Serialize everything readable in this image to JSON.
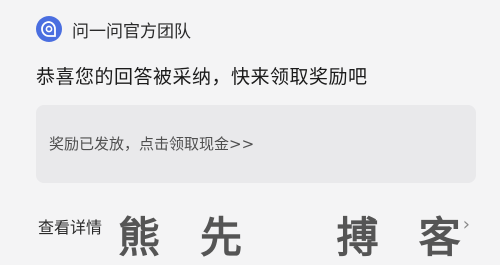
{
  "header": {
    "sender_name": "问一问官方团队",
    "avatar_icon": "question-bubble-icon",
    "accent_color": "#4a6ee0"
  },
  "message": {
    "text": "恭喜您的回答被采纳，快来领取奖励吧"
  },
  "reward": {
    "text": "奖励已发放，点击领取现金>>"
  },
  "footer": {
    "details_label": "查看详情",
    "chevron": "›"
  },
  "watermark": {
    "text": "熊先  搏客"
  }
}
